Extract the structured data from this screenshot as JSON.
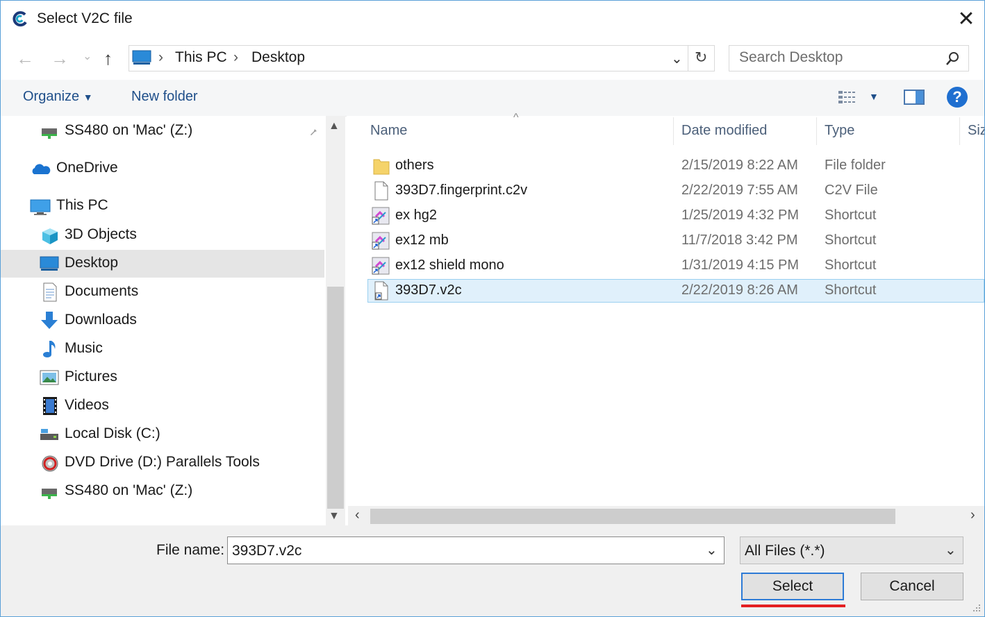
{
  "window": {
    "title": "Select V2C file"
  },
  "address": {
    "crumbs": [
      "This PC",
      "Desktop"
    ]
  },
  "search": {
    "placeholder": "Search Desktop"
  },
  "toolbar": {
    "organize": "Organize",
    "new_folder": "New folder"
  },
  "nav": {
    "items": [
      {
        "label": "SS480 on 'Mac' (Z:)",
        "icon": "network-drive-icon"
      },
      {
        "label": "OneDrive",
        "icon": "cloud-icon"
      },
      {
        "label": "This PC",
        "icon": "computer-icon"
      },
      {
        "label": "3D Objects",
        "icon": "cube-icon"
      },
      {
        "label": "Desktop",
        "icon": "desktop-icon"
      },
      {
        "label": "Documents",
        "icon": "document-icon"
      },
      {
        "label": "Downloads",
        "icon": "download-icon"
      },
      {
        "label": "Music",
        "icon": "music-icon"
      },
      {
        "label": "Pictures",
        "icon": "pictures-icon"
      },
      {
        "label": "Videos",
        "icon": "videos-icon"
      },
      {
        "label": "Local Disk (C:)",
        "icon": "disk-icon"
      },
      {
        "label": "DVD Drive (D:) Parallels Tools",
        "icon": "dvd-icon"
      },
      {
        "label": "SS480 on 'Mac' (Z:)",
        "icon": "network-drive-icon"
      }
    ],
    "selected": "Desktop"
  },
  "columns": {
    "name": "Name",
    "date": "Date modified",
    "type": "Type",
    "size": "Siz"
  },
  "files": [
    {
      "name": "others",
      "date": "2/15/2019 8:22 AM",
      "type": "File folder",
      "icon": "folder-icon"
    },
    {
      "name": "393D7.fingerprint.c2v",
      "date": "2/22/2019 7:55 AM",
      "type": "C2V File",
      "icon": "file-icon"
    },
    {
      "name": "ex hg2",
      "date": "1/25/2019 4:32 PM",
      "type": "Shortcut",
      "icon": "shortcut-icon"
    },
    {
      "name": "ex12 mb",
      "date": "11/7/2018 3:42 PM",
      "type": "Shortcut",
      "icon": "shortcut-icon"
    },
    {
      "name": "ex12 shield mono",
      "date": "1/31/2019 4:15 PM",
      "type": "Shortcut",
      "icon": "shortcut-icon"
    },
    {
      "name": "393D7.v2c",
      "date": "2/22/2019 8:26 AM",
      "type": "Shortcut",
      "icon": "shortcut-file-icon"
    }
  ],
  "selected_file": "393D7.v2c",
  "bottom": {
    "file_name_label": "File name:",
    "file_name_value": "393D7.v2c",
    "filter_value": "All Files (*.*)",
    "select_label": "Select",
    "cancel_label": "Cancel"
  },
  "colors": {
    "accent": "#2d7bd6",
    "selection": "#e0f0fb",
    "highlight_underline": "#e41f22"
  }
}
